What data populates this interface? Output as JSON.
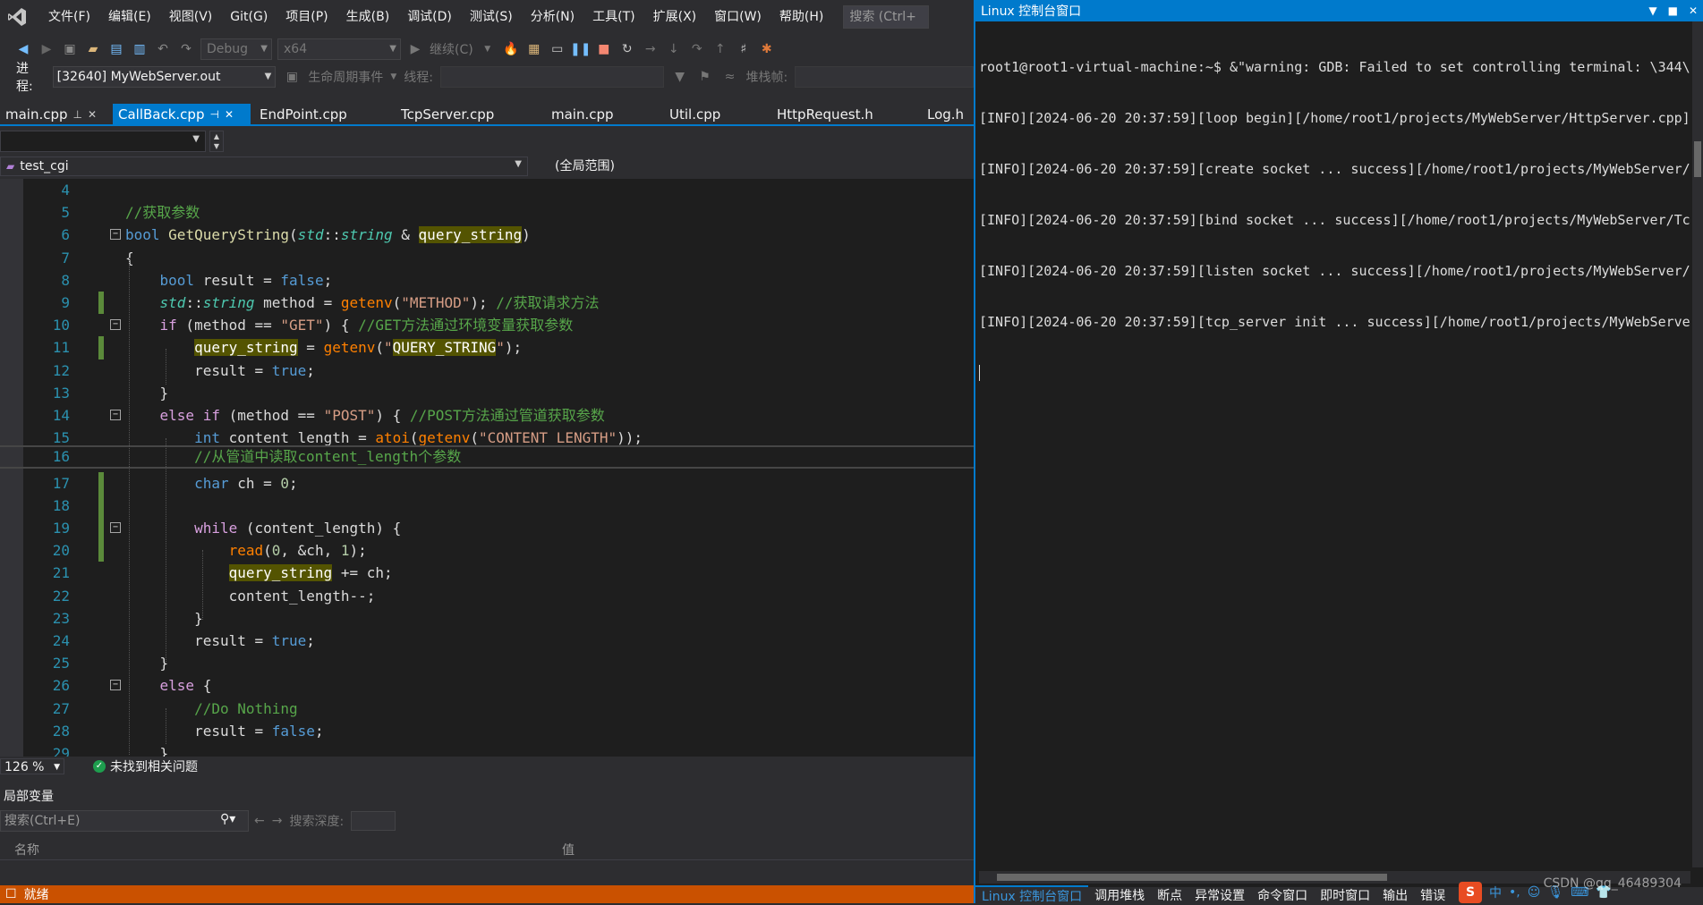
{
  "menu": {
    "items": [
      "文件(F)",
      "编辑(E)",
      "视图(V)",
      "Git(G)",
      "项目(P)",
      "生成(B)",
      "调试(D)",
      "测试(S)",
      "分析(N)",
      "工具(T)",
      "扩展(X)",
      "窗口(W)",
      "帮助(H)"
    ],
    "search_placeholder": "搜索 (Ctrl+"
  },
  "toolbar": {
    "config": "Debug",
    "platform": "x64",
    "continue_label": "继续(C)"
  },
  "procbar": {
    "process_label": "进程:",
    "process_value": "[32640] MyWebServer.out",
    "lifecycle_label": "生命周期事件",
    "thread_label": "线程:",
    "stackframe_label": "堆栈帧:"
  },
  "tabs": [
    {
      "label": "main.cpp",
      "active": false
    },
    {
      "label": "CallBack.cpp",
      "active": true
    },
    {
      "label": "EndPoint.cpp",
      "active": false
    },
    {
      "label": "TcpServer.cpp",
      "active": false
    },
    {
      "label": "main.cpp",
      "active": false
    },
    {
      "label": "Util.cpp",
      "active": false
    },
    {
      "label": "HttpRequest.h",
      "active": false
    },
    {
      "label": "Log.h",
      "active": false
    }
  ],
  "scope": {
    "function": "test_cgi",
    "range": "(全局范围)"
  },
  "editor": {
    "line_numbers": [
      "4",
      "5",
      "6",
      "7",
      "8",
      "9",
      "10",
      "11",
      "12",
      "13",
      "14",
      "15",
      "16",
      "17",
      "18",
      "19",
      "20",
      "21",
      "22",
      "23",
      "24",
      "25",
      "26",
      "27",
      "28",
      "29"
    ],
    "zoom": "126 %",
    "issues": "未找到相关问题"
  },
  "code": {
    "l5": "//获取参数",
    "l6_kw": "bool",
    "l6_fn": "GetQueryString",
    "l6_ns": "std",
    "l6_ty": "string",
    "l6_param": "query_string",
    "l8_kw": "bool",
    "l8_var": "result",
    "l8_val": "false",
    "l9_ns": "std",
    "l9_ty": "string",
    "l9_var": "method",
    "l9_fn": "getenv",
    "l9_str": "\"METHOD\"",
    "l9_cm": "//获取请求方法",
    "l10_kw": "if",
    "l10_var": "method",
    "l10_str": "\"GET\"",
    "l10_cm": "//GET方法通过环境变量获取参数",
    "l11_var": "query_string",
    "l11_fn": "getenv",
    "l11_str_pre": "\"",
    "l11_str_hl": "QUERY_STRING",
    "l11_str_post": "\"",
    "l12_var": "result",
    "l12_val": "true",
    "l14_kw1": "else",
    "l14_kw2": "if",
    "l14_var": "method",
    "l14_str": "\"POST\"",
    "l14_cm": "//POST方法通过管道获取参数",
    "l15_kw": "int",
    "l15_var": "content_length",
    "l15_fn1": "atoi",
    "l15_fn2": "getenv",
    "l15_str": "\"CONTENT_LENGTH\"",
    "l16_cm": "//从管道中读取content_length个参数",
    "l17_kw": "char",
    "l17_var": "ch",
    "l17_num": "0",
    "l19_kw": "while",
    "l19_var": "content_length",
    "l20_fn": "read",
    "l20_args_a": "0",
    "l20_args_b": "&ch",
    "l20_args_c": "1",
    "l21_var": "query_string",
    "l21_rhs": "ch",
    "l22_var": "content_length",
    "l24_var": "result",
    "l24_val": "true",
    "l26_kw": "else",
    "l27_cm": "//Do Nothing",
    "l28_var": "result",
    "l28_val": "false"
  },
  "locals": {
    "title": "局部变量",
    "search_placeholder": "搜索(Ctrl+E)",
    "depth_label": "搜索深度:",
    "col_name": "名称",
    "col_value": "值"
  },
  "status": {
    "ready": "就绪"
  },
  "console": {
    "title": "Linux 控制台窗口",
    "lines": [
      "root1@root1-virtual-machine:~$ &\"warning: GDB: Failed to set controlling terminal: \\344\\27",
      "[INFO][2024-06-20 20:37:59][loop begin][/home/root1/projects/MyWebServer/HttpServer.cpp][1",
      "[INFO][2024-06-20 20:37:59][create socket ... success][/home/root1/projects/MyWebServer/Tc",
      "[INFO][2024-06-20 20:37:59][bind socket ... success][/home/root1/projects/MyWebServer/TcpS",
      "[INFO][2024-06-20 20:37:59][listen socket ... success][/home/root1/projects/MyWebServer/Tc",
      "[INFO][2024-06-20 20:37:59][tcp_server init ... success][/home/root1/projects/MyWebServer/"
    ],
    "bottom_tabs": [
      "Linux 控制台窗口",
      "调用堆栈",
      "断点",
      "异常设置",
      "命令窗口",
      "即时窗口",
      "输出",
      "错误"
    ],
    "watermark": "CSDN @qq_46489304",
    "ime_label": "中"
  }
}
